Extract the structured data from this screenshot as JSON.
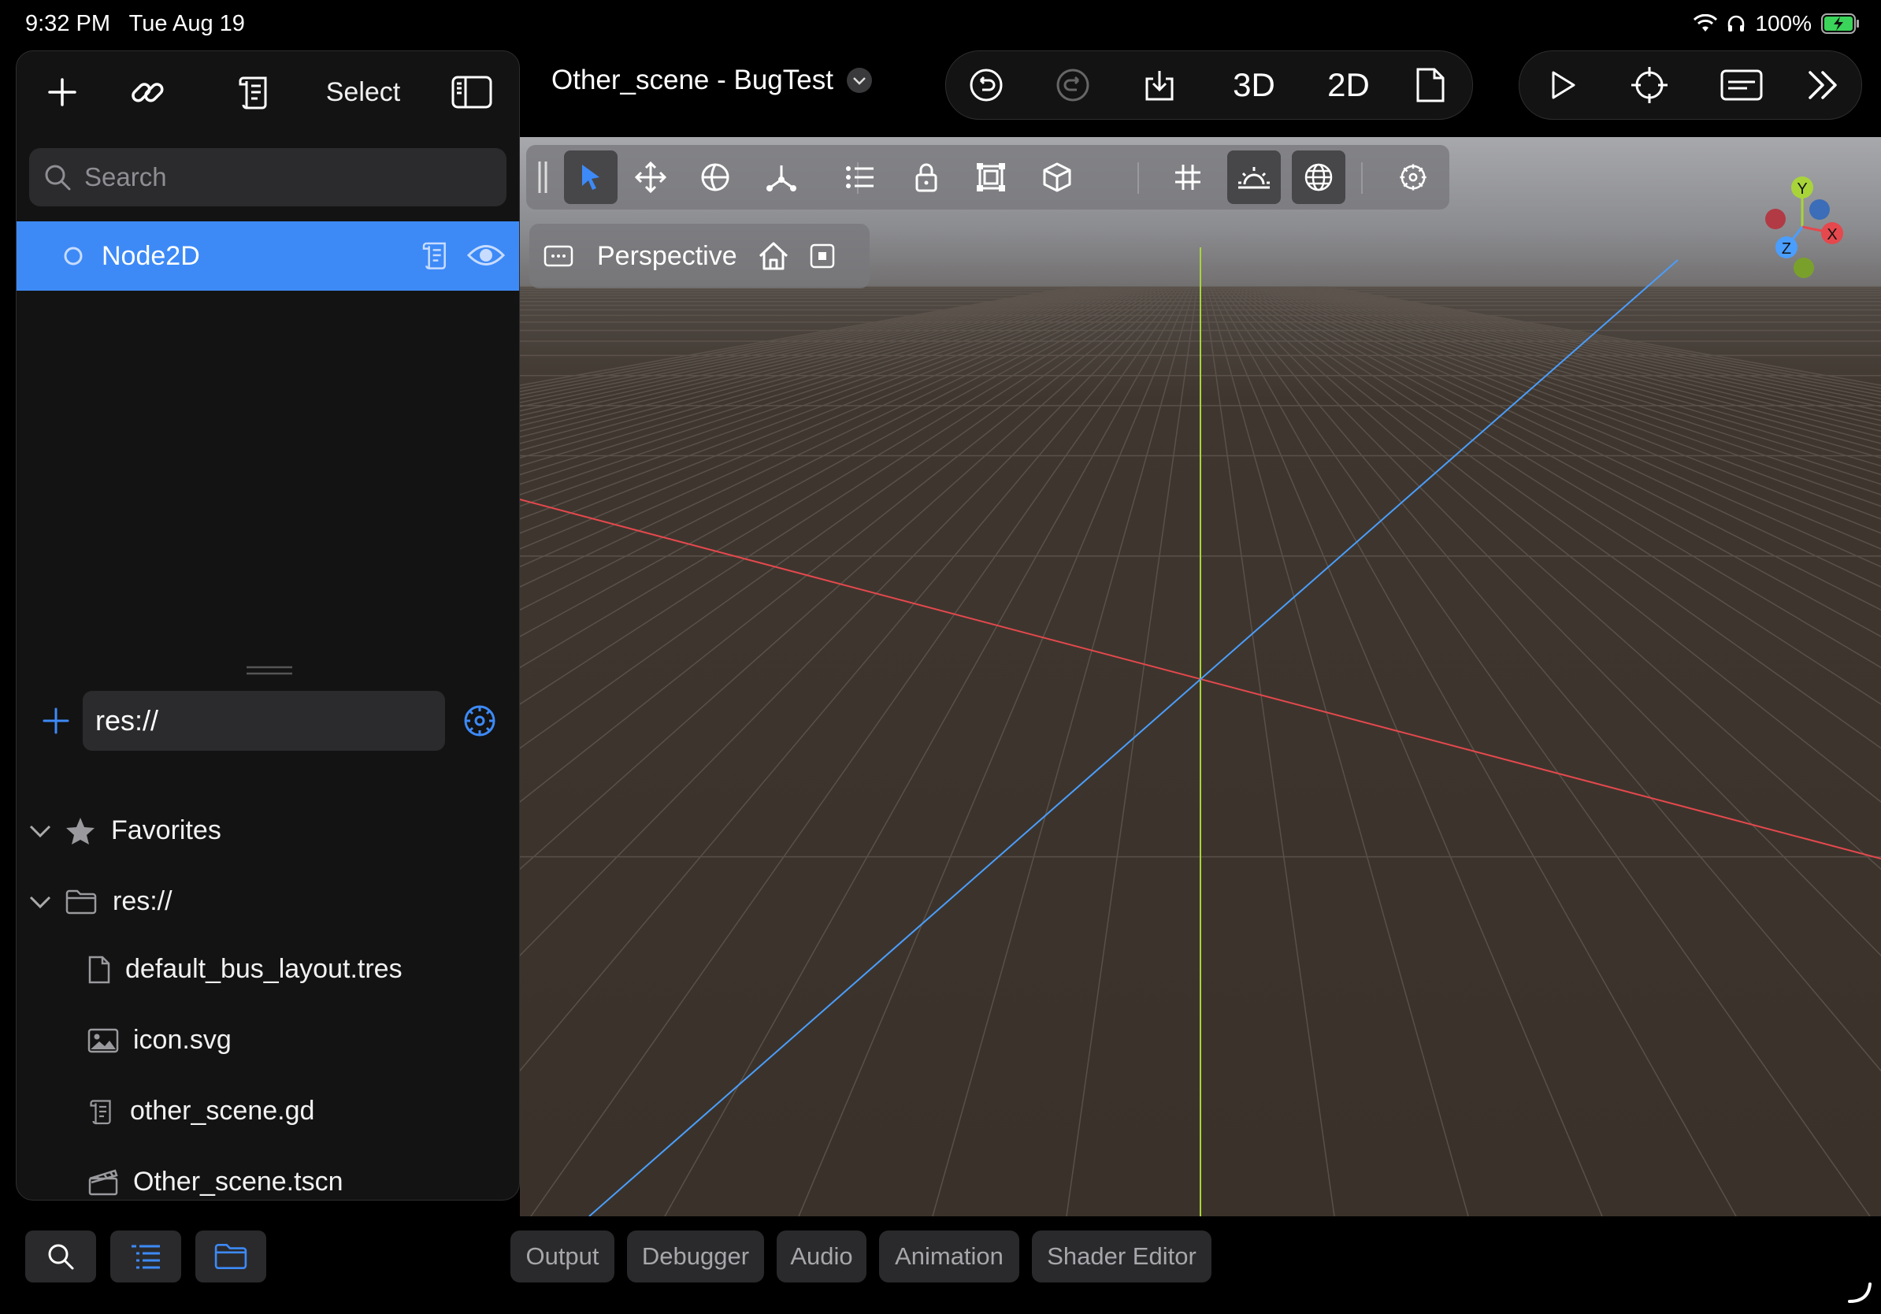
{
  "status_bar": {
    "time": "9:32 PM",
    "date": "Tue Aug 19",
    "battery": "100%"
  },
  "scene_panel": {
    "toolbar": {
      "select_label": "Select"
    },
    "search": {
      "placeholder": "Search"
    },
    "tree": [
      {
        "name": "Node2D",
        "selected": true,
        "icons": [
          "script-icon",
          "eye-icon"
        ]
      }
    ]
  },
  "filesystem": {
    "path": "res://",
    "favorites_label": "Favorites",
    "root_label": "res://",
    "files": [
      {
        "name": "default_bus_layout.tres",
        "icon": "file-icon"
      },
      {
        "name": "icon.svg",
        "icon": "image-icon"
      },
      {
        "name": "other_scene.gd",
        "icon": "script-icon"
      },
      {
        "name": "Other_scene.tscn",
        "icon": "clapperboard-icon"
      }
    ]
  },
  "top_bar": {
    "scene_title": "Other_scene - BugTest",
    "mode_3d": "3D",
    "mode_2d": "2D"
  },
  "viewport": {
    "perspective_label": "Perspective",
    "gizmo": {
      "x": "X",
      "y": "Y",
      "z": "Z"
    }
  },
  "bottom_tabs": [
    "Output",
    "Debugger",
    "Audio",
    "Animation",
    "Shader Editor"
  ],
  "colors": {
    "accent": "#3d8af7",
    "panel": "#131313",
    "x_axis": "#e5484d",
    "y_axis": "#a8d43a",
    "z_axis": "#4a9eff",
    "ground": "#3a322a"
  }
}
